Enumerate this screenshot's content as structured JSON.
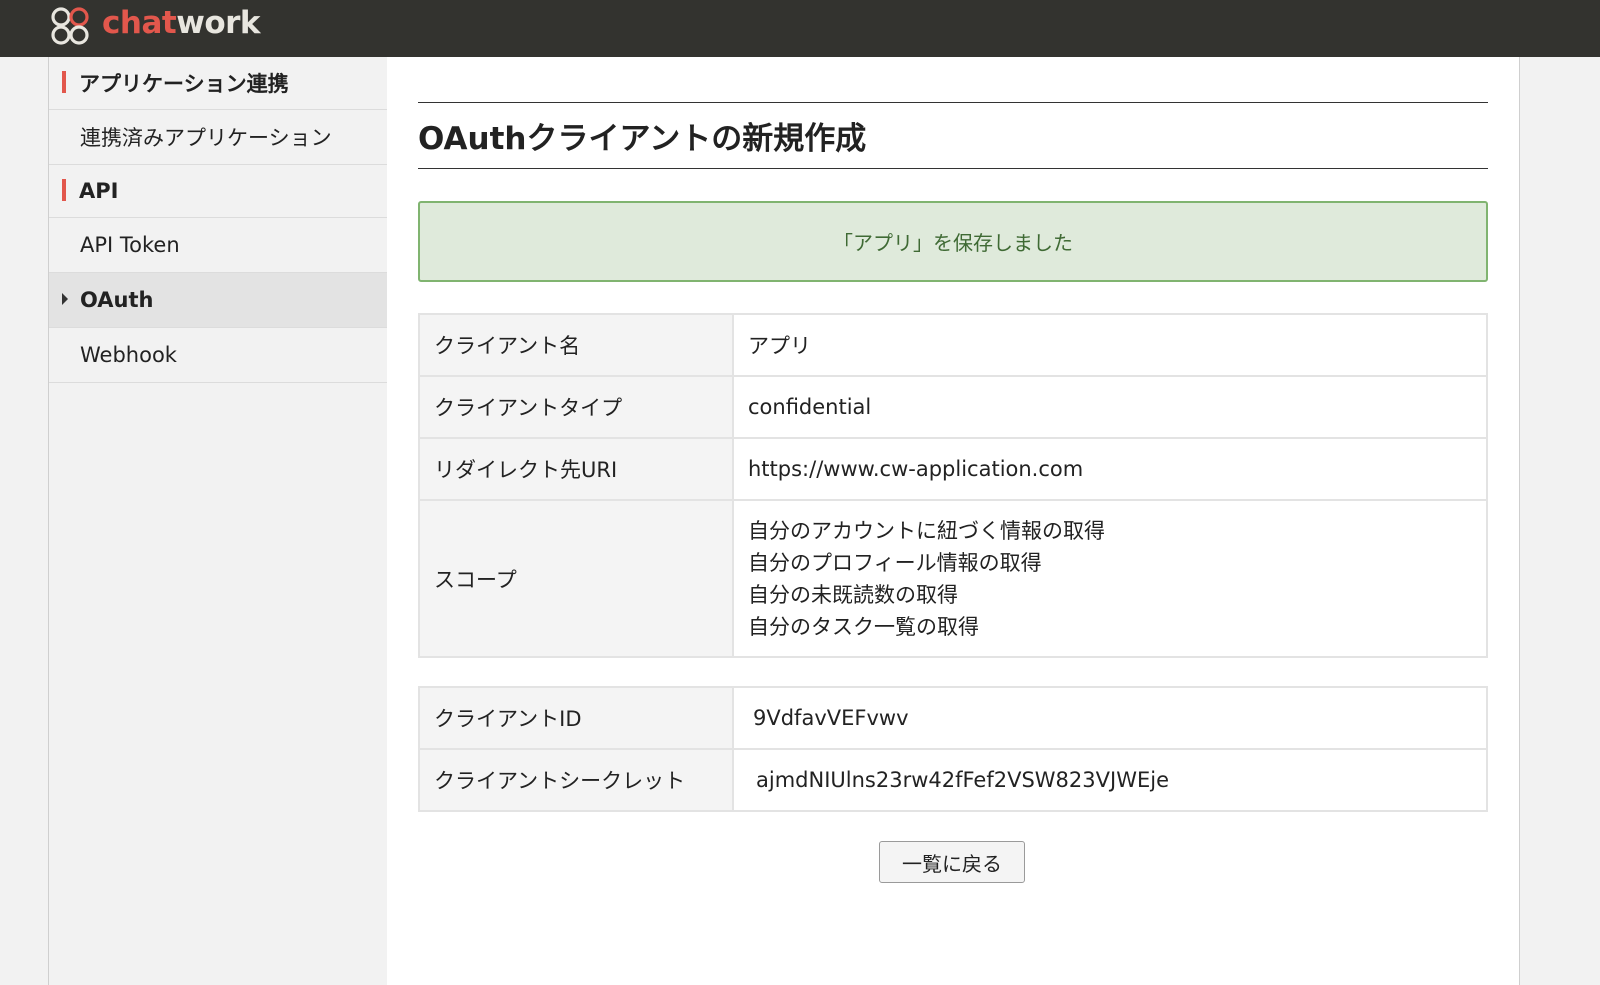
{
  "app": {
    "logo_text_1": "chat",
    "logo_text_2": "work",
    "brand_color": "#e2574c"
  },
  "sidebar": {
    "sections": [
      {
        "heading": "アプリケーション連携",
        "items": [
          {
            "label": "連携済みアプリケーション",
            "active": false
          }
        ]
      },
      {
        "heading": "API",
        "items": [
          {
            "label": "API Token",
            "active": false
          },
          {
            "label": "OAuth",
            "active": true
          },
          {
            "label": "Webhook",
            "active": false
          }
        ]
      }
    ]
  },
  "main": {
    "title": "OAuthクライアントの新規作成",
    "notice": "「アプリ」を保存しました",
    "details": {
      "client_name_label": "クライアント名",
      "client_name_value": "アプリ",
      "client_type_label": "クライアントタイプ",
      "client_type_value": "confidential",
      "redirect_uri_label": "リダイレクト先URI",
      "redirect_uri_value": "https://www.cw-application.com",
      "scope_label": "スコープ",
      "scopes": [
        "自分のアカウントに紐づく情報の取得",
        "自分のプロフィール情報の取得",
        "自分の未既読数の取得",
        "自分のタスク一覧の取得"
      ]
    },
    "credentials": {
      "client_id_label": "クライアントID",
      "client_id_value": "9VdfavVEFvwv",
      "client_secret_label": "クライアントシークレット",
      "client_secret_value": "ajmdNIUlns23rw42fFef2VSW823VJWEje"
    },
    "back_button": "一覧に戻る"
  }
}
